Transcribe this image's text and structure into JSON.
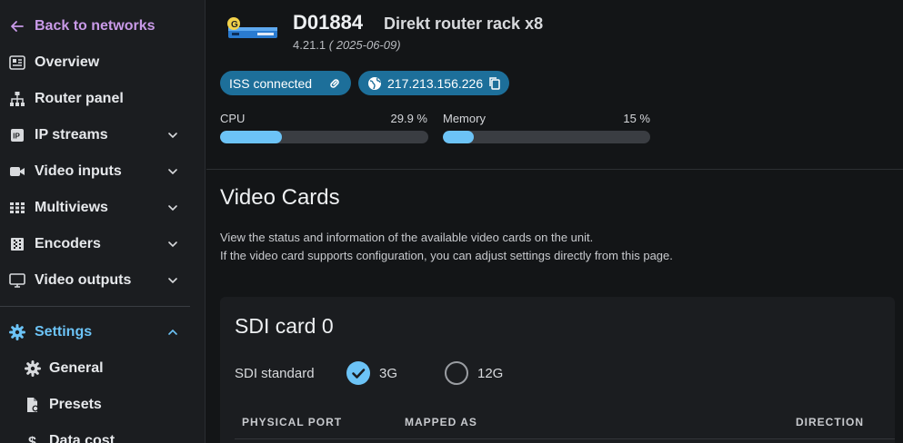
{
  "sidebar": {
    "back_label": "Back to networks",
    "items": [
      {
        "label": "Overview",
        "icon": "overview-icon"
      },
      {
        "label": "Router panel",
        "icon": "router-panel-icon"
      },
      {
        "label": "IP streams",
        "icon": "ip-icon"
      },
      {
        "label": "Video inputs",
        "icon": "video-camera-icon"
      },
      {
        "label": "Multiviews",
        "icon": "grid-icon"
      },
      {
        "label": "Encoders",
        "icon": "encoder-icon"
      },
      {
        "label": "Video outputs",
        "icon": "monitor-icon"
      }
    ],
    "settings": {
      "label": "Settings",
      "children": [
        {
          "label": "General",
          "icon": "gear-icon"
        },
        {
          "label": "Presets",
          "icon": "preset-file-icon"
        },
        {
          "label": "Data cost",
          "icon": "dollar-icon"
        }
      ]
    }
  },
  "device": {
    "id": "D01884",
    "name": "Direkt router rack x8",
    "version": "4.21.1",
    "date": "( 2025-06-09)",
    "badge": "G",
    "iss_label": "ISS connected",
    "ip": "217.213.156.226"
  },
  "meters": {
    "cpu": {
      "label": "CPU",
      "value_text": "29.9 %",
      "fraction": 0.299
    },
    "memory": {
      "label": "Memory",
      "value_text": "15 %",
      "fraction": 0.15
    }
  },
  "main": {
    "title": "Video Cards",
    "desc_line1": "View the status and information of the available video cards on the unit.",
    "desc_line2": "If the video card supports configuration, you can adjust settings directly from this page."
  },
  "card": {
    "title": "SDI card 0",
    "standard_label": "SDI standard",
    "options": [
      {
        "label": "3G",
        "selected": true
      },
      {
        "label": "12G",
        "selected": false
      }
    ],
    "columns": [
      "PHYSICAL PORT",
      "MAPPED AS",
      "DIRECTION"
    ]
  },
  "colors": {
    "accent": "#6cc3f6",
    "back_link": "#c99ae8",
    "pill": "#1d6f9a",
    "settings": "#6cc3f6"
  }
}
